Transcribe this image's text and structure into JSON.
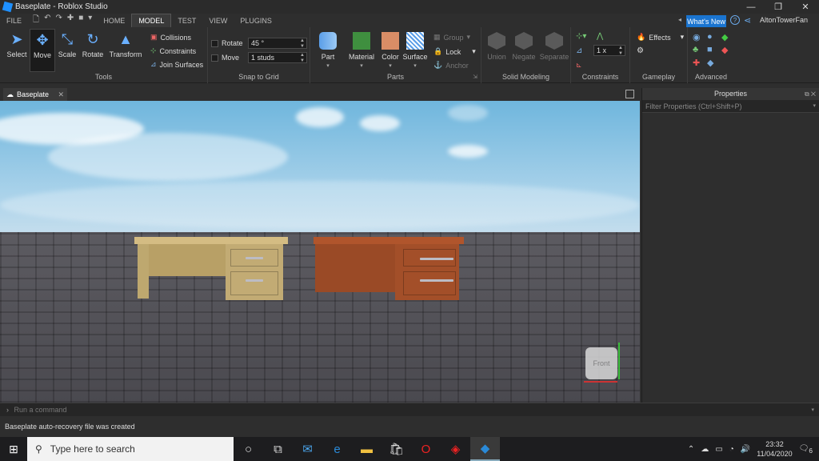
{
  "titlebar": {
    "title": "Baseplate - Roblox Studio",
    "buttons": [
      "minimize-icon",
      "restore-icon",
      "close-icon"
    ]
  },
  "menubar": {
    "items": [
      "FILE",
      "HOME",
      "MODEL",
      "TEST",
      "VIEW",
      "PLUGINS"
    ],
    "active": "MODEL",
    "whats_new": "What's New",
    "user": "AltonTowerFan"
  },
  "ribbon": {
    "tools": {
      "label": "Tools",
      "select": "Select",
      "move": "Move",
      "scale": "Scale",
      "rotate": "Rotate",
      "transform": "Transform",
      "collisions": "Collisions",
      "constraints": "Constraints",
      "join_surfaces": "Join Surfaces"
    },
    "snap": {
      "label": "Snap to Grid",
      "rotate_label": "Rotate",
      "rotate_value": "45 °",
      "move_label": "Move",
      "move_value": "1 studs"
    },
    "parts": {
      "label": "Parts",
      "part": "Part",
      "material": "Material",
      "color": "Color",
      "surface": "Surface",
      "group": "Group",
      "lock": "Lock",
      "anchor": "Anchor",
      "material_color": "#3f8f3f",
      "color_swatch": "#d98d66"
    },
    "solid": {
      "label": "Solid Modeling",
      "union": "Union",
      "negate": "Negate",
      "separate": "Separate"
    },
    "constraints": {
      "label": "Constraints",
      "scale_value": "1 x"
    },
    "gameplay": {
      "label": "Gameplay",
      "effects": "Effects"
    },
    "advanced": {
      "label": "Advanced"
    }
  },
  "doc": {
    "tab": "Baseplate"
  },
  "viewport": {
    "front_cube": "Front"
  },
  "properties": {
    "title": "Properties",
    "filter_placeholder": "Filter Properties (Ctrl+Shift+P)"
  },
  "command": {
    "placeholder": "Run a command"
  },
  "status": {
    "text": "Baseplate auto-recovery file was created"
  },
  "taskbar": {
    "search_placeholder": "Type here to search",
    "time": "23:32",
    "date": "11/04/2020",
    "notifications": "6"
  }
}
